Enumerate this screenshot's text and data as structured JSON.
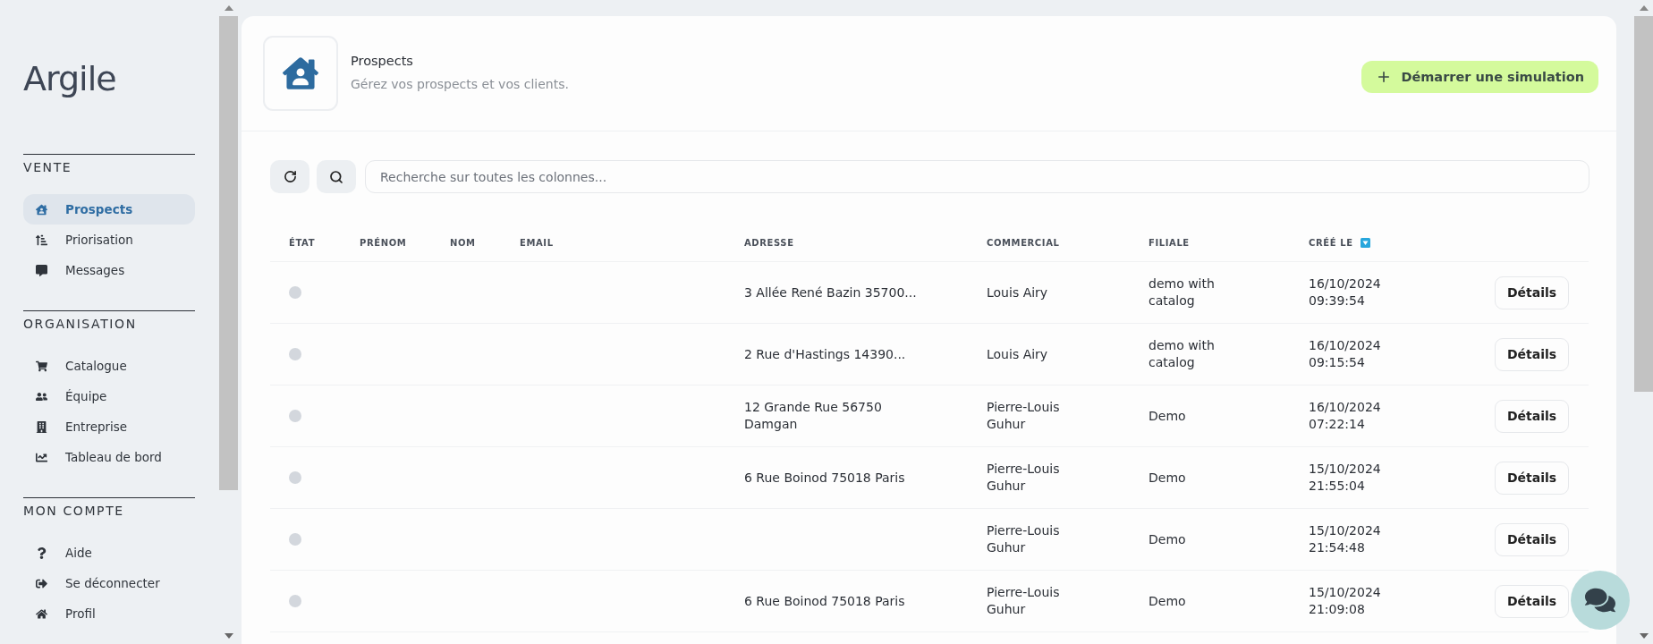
{
  "sidebar": {
    "logo": "Argile",
    "sections": [
      {
        "title": "VENTE",
        "items": [
          {
            "label": "Prospects",
            "selected": true
          },
          {
            "label": "Priorisation",
            "selected": false
          },
          {
            "label": "Messages",
            "selected": false
          }
        ]
      },
      {
        "title": "ORGANISATION",
        "items": [
          {
            "label": "Catalogue",
            "selected": false
          },
          {
            "label": "Équipe",
            "selected": false
          },
          {
            "label": "Entreprise",
            "selected": false
          },
          {
            "label": "Tableau de bord",
            "selected": false
          }
        ]
      },
      {
        "title": "MON COMPTE",
        "items": [
          {
            "label": "Aide",
            "selected": false
          },
          {
            "label": "Se déconnecter",
            "selected": false
          },
          {
            "label": "Profil",
            "selected": false
          }
        ]
      }
    ]
  },
  "header": {
    "title": "Prospects",
    "subtitle": "Gérez vos prospects et vos clients.",
    "action": "Démarrer une simulation"
  },
  "toolbar": {
    "search_placeholder": "Recherche sur toutes les colonnes..."
  },
  "table": {
    "columns": [
      {
        "label": "ÉTAT",
        "sorted": false
      },
      {
        "label": "PRÉNOM",
        "sorted": false
      },
      {
        "label": "NOM",
        "sorted": false
      },
      {
        "label": "EMAIL",
        "sorted": false
      },
      {
        "label": "ADRESSE",
        "sorted": false
      },
      {
        "label": "COMMERCIAL",
        "sorted": false
      },
      {
        "label": "FILIALE",
        "sorted": false
      },
      {
        "label": "CRÉÉ LE",
        "sorted": true
      }
    ],
    "rows": [
      {
        "address": "3 Allée René Bazin 35700...",
        "commercial": "Louis Airy",
        "subsidiary": "demo with\ncatalog",
        "created": "16/10/2024\n09:39:54",
        "action": "Détails"
      },
      {
        "address": "2 Rue d'Hastings 14390...",
        "commercial": "Louis Airy",
        "subsidiary": "demo with\ncatalog",
        "created": "16/10/2024\n09:15:54",
        "action": "Détails"
      },
      {
        "address": "12 Grande Rue 56750\nDamgan",
        "commercial": "Pierre-Louis\nGuhur",
        "subsidiary": "Demo",
        "created": "16/10/2024\n07:22:14",
        "action": "Détails"
      },
      {
        "address": "6 Rue Boinod 75018 Paris",
        "commercial": "Pierre-Louis\nGuhur",
        "subsidiary": "Demo",
        "created": "15/10/2024\n21:55:04",
        "action": "Détails"
      },
      {
        "commercial": "Pierre-Louis\nGuhur",
        "subsidiary": "Demo",
        "created": "15/10/2024\n21:54:48",
        "action": "Détails"
      },
      {
        "address": "6 Rue Boinod 75018 Paris",
        "commercial": "Pierre-Louis\nGuhur",
        "subsidiary": "Demo",
        "created": "15/10/2024\n21:09:08",
        "action": "Détails"
      }
    ]
  }
}
